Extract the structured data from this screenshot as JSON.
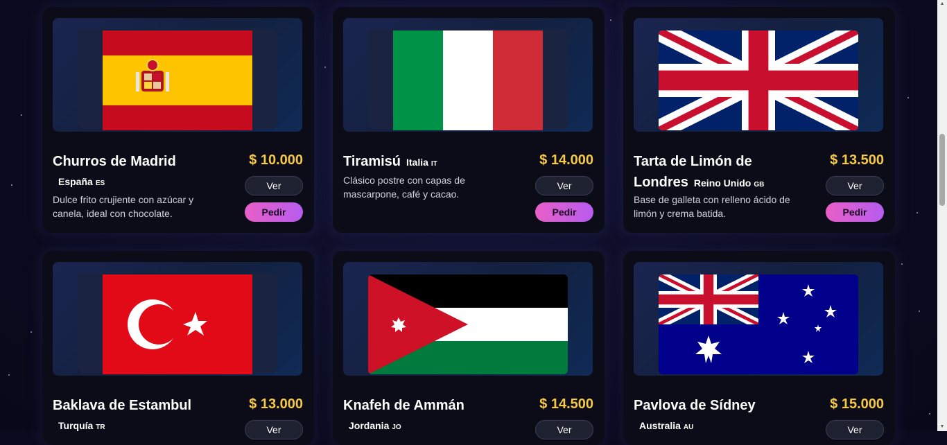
{
  "labels": {
    "view": "Ver",
    "order": "Pedir"
  },
  "colors": {
    "price": "#f7c948",
    "order_button": "#e85fc7",
    "card": "#0c0c18"
  },
  "cards": [
    {
      "title": "Churros de Madrid",
      "country": "España",
      "code": "ES",
      "price": "$ 10.000",
      "description": "Dulce frito crujiente con azúcar y canela, ideal con chocolate.",
      "flag": "spain-flag"
    },
    {
      "title": "Tiramisú",
      "country": "Italia",
      "code": "IT",
      "price": "$ 14.000",
      "description": "Clásico postre con capas de mascarpone, café y cacao.",
      "flag": "italy-flag"
    },
    {
      "title": "Tarta de Limón de Londres",
      "country": "Reino Unido",
      "code": "GB",
      "price": "$ 13.500",
      "description": "Base de galleta con relleno ácido de limón y crema batida.",
      "flag": "uk-flag"
    },
    {
      "title": "Baklava de Estambul",
      "country": "Turquía",
      "code": "TR",
      "price": "$ 13.000",
      "flag": "turkey-flag"
    },
    {
      "title": "Knafeh de Ammán",
      "country": "Jordania",
      "code": "JO",
      "price": "$ 14.500",
      "flag": "jordan-flag"
    },
    {
      "title": "Pavlova de Sídney",
      "country": "Australia",
      "code": "AU",
      "price": "$ 15.000",
      "flag": "australia-flag"
    }
  ]
}
